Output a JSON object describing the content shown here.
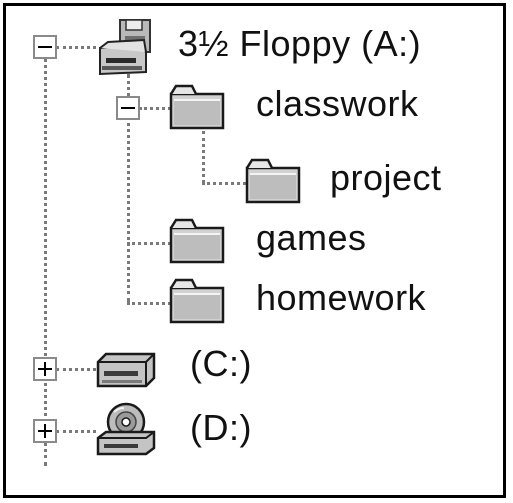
{
  "tree": {
    "floppy": {
      "label": "3½ Floppy (A:)",
      "icon": "floppy-drive-icon",
      "expanded": true
    },
    "classwork": {
      "label": "classwork",
      "icon": "folder-icon",
      "expanded": true
    },
    "project": {
      "label": "project",
      "icon": "folder-icon"
    },
    "games": {
      "label": "games",
      "icon": "folder-icon"
    },
    "homework": {
      "label": "homework",
      "icon": "folder-icon"
    },
    "drive_c": {
      "label": "(C:)",
      "icon": "hard-drive-icon",
      "expanded": false
    },
    "drive_d": {
      "label": "(D:)",
      "icon": "cd-drive-icon",
      "expanded": false
    }
  }
}
